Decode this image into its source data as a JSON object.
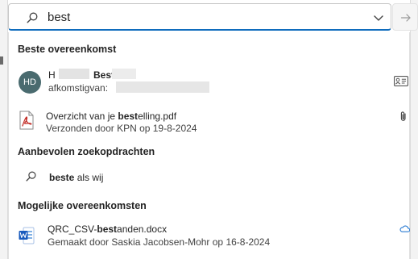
{
  "search": {
    "value": "best",
    "placeholder": ""
  },
  "sections": {
    "best_match": "Beste overeenkomst",
    "suggested_searches": "Aanbevolen zoekopdrachten",
    "possible_matches": "Mogelijke overeenkomsten"
  },
  "contact": {
    "avatar_initials": "HD",
    "name_first_visible": "H",
    "name_last": "Best",
    "email_prefix": "afkomstigvan:"
  },
  "pdf_result": {
    "title_prefix": "Overzicht van je ",
    "title_highlight": "best",
    "title_suffix": "elling.pdf",
    "subtitle": "Verzonden door KPN op 19-8-2024"
  },
  "suggestion": {
    "highlight": "beste",
    "rest": " als wij"
  },
  "docx_result": {
    "title_prefix": "QRC_CSV-",
    "title_highlight": "best",
    "title_suffix": "anden.docx",
    "subtitle": "Gemaakt door Saskia Jacobsen-Mohr op 16-8-2024"
  },
  "icons": {
    "search": "search-icon",
    "dropdown": "chevron-down-icon",
    "go": "arrow-right-icon",
    "contact_card": "contact-card-icon",
    "attachment": "paperclip-icon",
    "pdf": "pdf-file-icon",
    "word": "word-file-icon",
    "cloud": "cloud-icon"
  },
  "colors": {
    "accent": "#0f6cbd",
    "avatar_bg": "#4a6b6f",
    "pdf_red": "#c4312b",
    "word_blue": "#185abd"
  }
}
